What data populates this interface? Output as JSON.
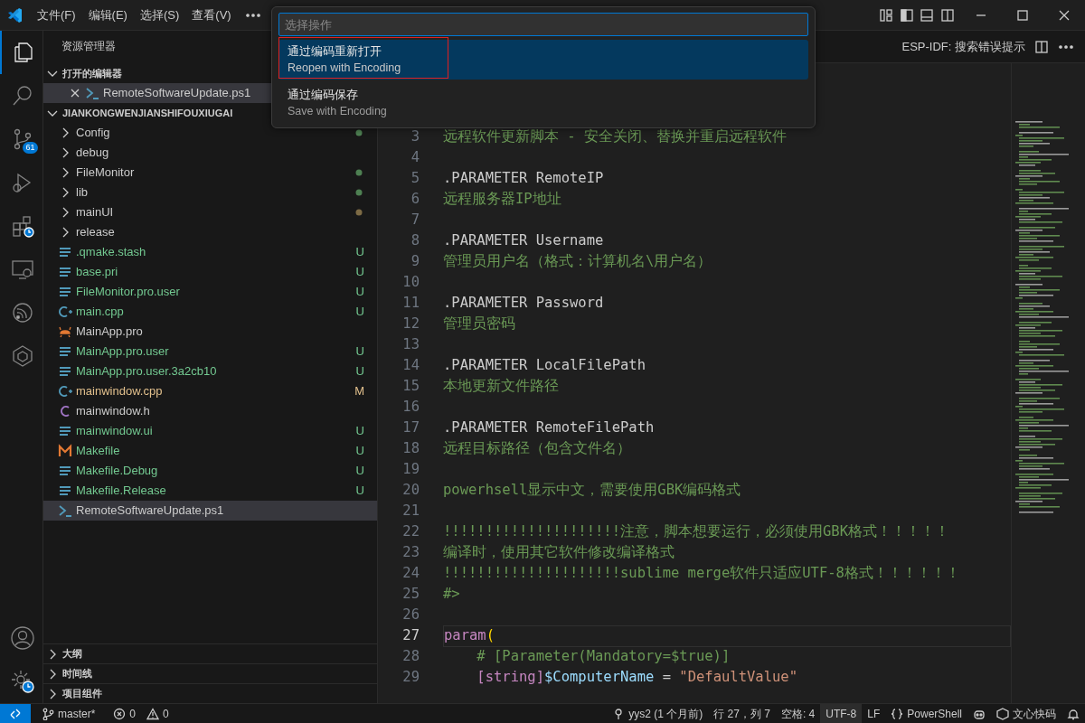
{
  "menu": [
    "文件(F)",
    "编辑(E)",
    "选择(S)",
    "查看(V)"
  ],
  "palette": {
    "placeholder": "选择操作",
    "items": [
      {
        "title": "通过编码重新打开",
        "subtitle": "Reopen with Encoding",
        "selected": true,
        "annotated": true
      },
      {
        "title": "通过编码保存",
        "subtitle": "Save with Encoding",
        "selected": false,
        "annotated": false
      }
    ]
  },
  "activity": [
    {
      "kind": "files",
      "selected": true
    },
    {
      "kind": "search",
      "selected": false
    },
    {
      "kind": "git",
      "selected": false,
      "badge": "61"
    },
    {
      "kind": "debug",
      "selected": false
    },
    {
      "kind": "extensions",
      "selected": false
    },
    {
      "kind": "remote",
      "selected": false
    },
    {
      "kind": "espidf",
      "selected": false
    },
    {
      "kind": "hexagon",
      "selected": false
    }
  ],
  "sidebar": {
    "title": "资源管理器",
    "open_editors": {
      "label": "打开的编辑器",
      "expanded": true,
      "items": [
        {
          "name": "RemoteSoftwareUpdate.ps1",
          "kind": "shell"
        }
      ]
    },
    "workspace": {
      "label": "JIANKONGWENJIANSHIFOUXIUGAI",
      "expanded": true,
      "items": [
        {
          "name": "Config",
          "kind": "folder",
          "dot": {
            "color": "#4e8052"
          },
          "selected": false
        },
        {
          "name": "debug",
          "kind": "folder",
          "selected": false
        },
        {
          "name": "FileMonitor",
          "kind": "folder",
          "dot": {
            "color": "#4e8052"
          },
          "selected": false
        },
        {
          "name": "lib",
          "kind": "folder",
          "dot": {
            "color": "#4e8052"
          },
          "selected": false
        },
        {
          "name": "mainUI",
          "kind": "folder",
          "dot": {
            "color": "#7d6b45"
          },
          "selected": false
        },
        {
          "name": "release",
          "kind": "folder",
          "selected": false
        },
        {
          "name": ".qmake.stash",
          "kind": "lines",
          "color": "#73c991",
          "badge": "U",
          "selected": false
        },
        {
          "name": "base.pri",
          "kind": "lines",
          "color": "#73c991",
          "badge": "U",
          "selected": false
        },
        {
          "name": "FileMonitor.pro.user",
          "kind": "lines",
          "color": "#73c991",
          "badge": "U",
          "selected": false
        },
        {
          "name": "main.cpp",
          "kind": "cpp",
          "color": "#73c991",
          "badge": "U",
          "selected": false
        },
        {
          "name": "MainApp.pro",
          "kind": "pro",
          "selected": false
        },
        {
          "name": "MainApp.pro.user",
          "kind": "lines",
          "color": "#73c991",
          "badge": "U",
          "selected": false
        },
        {
          "name": "MainApp.pro.user.3a2cb10",
          "kind": "lines",
          "color": "#73c991",
          "badge": "U",
          "selected": false
        },
        {
          "name": "mainwindow.cpp",
          "kind": "cpp",
          "color": "#e2c08d",
          "badge": "M",
          "selected": false
        },
        {
          "name": "mainwindow.h",
          "kind": "c",
          "selected": false
        },
        {
          "name": "mainwindow.ui",
          "kind": "lines",
          "color": "#73c991",
          "badge": "U",
          "selected": false
        },
        {
          "name": "Makefile",
          "kind": "make",
          "color": "#73c991",
          "badge": "U",
          "selected": false
        },
        {
          "name": "Makefile.Debug",
          "kind": "lines",
          "color": "#73c991",
          "badge": "U",
          "selected": false
        },
        {
          "name": "Makefile.Release",
          "kind": "lines",
          "color": "#73c991",
          "badge": "U",
          "selected": false
        },
        {
          "name": "RemoteSoftwareUpdate.ps1",
          "kind": "shell",
          "selected": true
        }
      ]
    },
    "bottom_sections": [
      {
        "label": "大纲",
        "expanded": false
      },
      {
        "label": "时间线",
        "expanded": false
      },
      {
        "label": "项目组件",
        "expanded": false
      }
    ]
  },
  "editor_actions": {
    "command": "ESP-IDF: 搜索错误提示"
  },
  "code": [
    {
      "n": "3",
      "current": false,
      "segs": [
        {
          "t": "远程软件更新脚本 - 安全关闭、替换并重启远程软件",
          "kind": "comment"
        }
      ]
    },
    {
      "n": "4",
      "current": false
    },
    {
      "n": "5",
      "current": false,
      "segs": [
        {
          "t": ".PARAMETER RemoteIP",
          "kind": "doc"
        }
      ]
    },
    {
      "n": "6",
      "current": false,
      "segs": [
        {
          "t": "远程服务器IP地址",
          "kind": "comment"
        }
      ]
    },
    {
      "n": "7",
      "current": false
    },
    {
      "n": "8",
      "current": false,
      "segs": [
        {
          "t": ".PARAMETER Username",
          "kind": "doc"
        }
      ]
    },
    {
      "n": "9",
      "current": false,
      "segs": [
        {
          "t": "管理员用户名（格式：计算机名\\用户名）",
          "kind": "comment"
        }
      ]
    },
    {
      "n": "10",
      "current": false
    },
    {
      "n": "11",
      "current": false,
      "segs": [
        {
          "t": ".PARAMETER Password",
          "kind": "doc"
        }
      ]
    },
    {
      "n": "12",
      "current": false,
      "segs": [
        {
          "t": "管理员密码",
          "kind": "comment"
        }
      ]
    },
    {
      "n": "13",
      "current": false
    },
    {
      "n": "14",
      "current": false,
      "segs": [
        {
          "t": ".PARAMETER LocalFilePath",
          "kind": "doc"
        }
      ]
    },
    {
      "n": "15",
      "current": false,
      "segs": [
        {
          "t": "本地更新文件路径",
          "kind": "comment"
        }
      ]
    },
    {
      "n": "16",
      "current": false
    },
    {
      "n": "17",
      "current": false,
      "segs": [
        {
          "t": ".PARAMETER RemoteFilePath",
          "kind": "doc"
        }
      ]
    },
    {
      "n": "18",
      "current": false,
      "segs": [
        {
          "t": "远程目标路径（包含文件名）",
          "kind": "comment"
        }
      ]
    },
    {
      "n": "19",
      "current": false
    },
    {
      "n": "20",
      "current": false,
      "segs": [
        {
          "t": "powerhsell显示中文，需要使用GBK编码格式",
          "kind": "comment"
        }
      ]
    },
    {
      "n": "21",
      "current": false
    },
    {
      "n": "22",
      "current": false,
      "segs": [
        {
          "t": "!!!!!!!!!!!!!!!!!!!!!注意，脚本想要运行，必须使用GBK格式！！！！！",
          "kind": "comment"
        }
      ]
    },
    {
      "n": "23",
      "current": false,
      "segs": [
        {
          "t": "编译时，使用其它软件修改编译格式",
          "kind": "comment"
        }
      ]
    },
    {
      "n": "24",
      "current": false,
      "segs": [
        {
          "t": "!!!!!!!!!!!!!!!!!!!!!sublime merge软件只适应UTF-8格式！！！！！！",
          "kind": "comment"
        }
      ]
    },
    {
      "n": "25",
      "current": false,
      "segs": [
        {
          "t": "#>",
          "kind": "comment"
        }
      ]
    },
    {
      "n": "26",
      "current": false
    },
    {
      "n": "27",
      "current": true,
      "segs": [
        {
          "t": "param",
          "kind": "keyword"
        },
        {
          "t": "(",
          "kind": "bracket"
        }
      ]
    },
    {
      "n": "28",
      "current": false,
      "segs": [
        {
          "t": "    # [Parameter(Mandatory=$true)]",
          "kind": "comment"
        }
      ]
    },
    {
      "n": "29",
      "current": false,
      "segs": [
        {
          "t": "    [string]",
          "kind": "type"
        },
        {
          "t": "$ComputerName",
          "kind": "variable"
        },
        {
          "t": " = ",
          "kind": "plain"
        },
        {
          "t": "\"DefaultValue\"",
          "kind": "string"
        }
      ]
    }
  ],
  "status_left": [
    {
      "text": "master*",
      "kind": "branch"
    },
    {
      "text": "0",
      "kind": "error"
    },
    {
      "text": "0",
      "kind": "warning"
    }
  ],
  "status_right": [
    {
      "text": "yys2 (1 个月前)",
      "kind": "commit",
      "hovered": false
    },
    {
      "text": "行 27，列 7",
      "hovered": false
    },
    {
      "text": "空格: 4",
      "hovered": false
    },
    {
      "text": "UTF-8",
      "hovered": true
    },
    {
      "text": "LF",
      "hovered": false
    },
    {
      "text": "PowerShell",
      "kind": "braces",
      "hovered": false
    },
    {
      "kind": "copilot",
      "hovered": false
    },
    {
      "text": "文心快码",
      "kind": "wenxin",
      "hovered": false
    },
    {
      "kind": "bell",
      "hovered": false
    }
  ]
}
